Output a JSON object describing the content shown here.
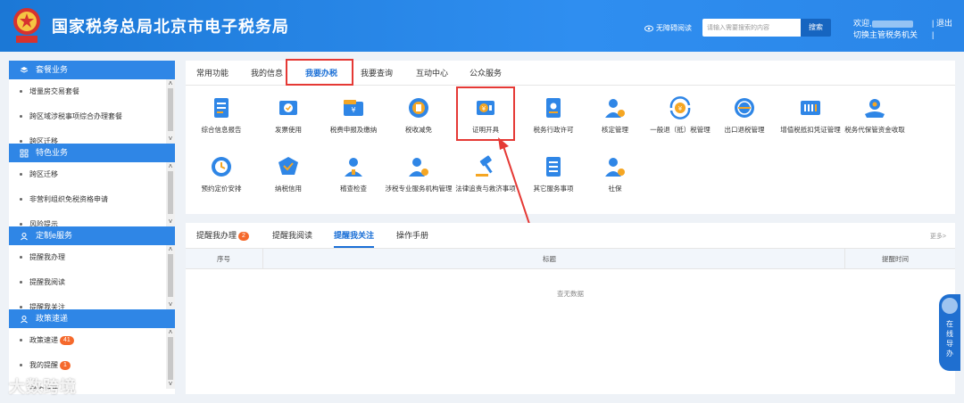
{
  "header": {
    "title": "国家税务总局北京市电子税务局",
    "a11y_label": "无障碍阅读",
    "search_placeholder": "请输入需要搜索的内容",
    "search_button": "搜索",
    "welcome_prefix": "欢迎,",
    "switch_label": "切换主管税务机关",
    "logout_label": "退出",
    "divider": "|"
  },
  "sidebar": {
    "sections": [
      {
        "title": "套餐业务",
        "items": [
          "增量房交易套餐",
          "跨区域涉税事项综合办理套餐",
          "跨区迁移"
        ]
      },
      {
        "title": "特色业务",
        "items": [
          "跨区迁移",
          "非营利组织免税资格申请",
          "风险提示"
        ]
      },
      {
        "title": "定制e服务",
        "items": [
          "提醒我办理",
          "提醒我阅读",
          "提醒我关注"
        ]
      },
      {
        "title": "政策速递",
        "items": [
          "政策速递",
          "我的提醒",
          "我的收藏"
        ],
        "badges": [
          "41",
          "1"
        ]
      }
    ]
  },
  "main": {
    "tabs": [
      "常用功能",
      "我的信息",
      "我要办税",
      "我要查询",
      "互动中心",
      "公众服务"
    ],
    "active_tab": "我要办税",
    "functions_row1": [
      "综合信息报告",
      "发票使用",
      "税费申报及缴纳",
      "税收减免",
      "证明开具",
      "税务行政许可",
      "核定管理",
      "一般退（抵）税管理",
      "出口退税管理",
      "增值税抵扣凭证管理",
      "税务代保管资金收取"
    ],
    "functions_row2": [
      "预约定价安排",
      "纳税信用",
      "稽查检查",
      "涉税专业服务机构管理",
      "法律追责与救济事项",
      "其它服务事项",
      "社保"
    ]
  },
  "lower": {
    "tabs": [
      "提醒我办理",
      "提醒我阅读",
      "提醒我关注",
      "操作手册"
    ],
    "badge": "2",
    "more": "更多>",
    "columns": [
      "序号",
      "标题",
      "提醒时间"
    ],
    "empty_text": "查无数据"
  },
  "guide": {
    "text": "在线导办"
  },
  "watermark": "大数跨境",
  "colors": {
    "header_bg": "#1b78d6",
    "accent": "#1a6fd6",
    "highlight": "#e53935",
    "icon_blue": "#2f86e6",
    "icon_orange": "#f5a623"
  }
}
